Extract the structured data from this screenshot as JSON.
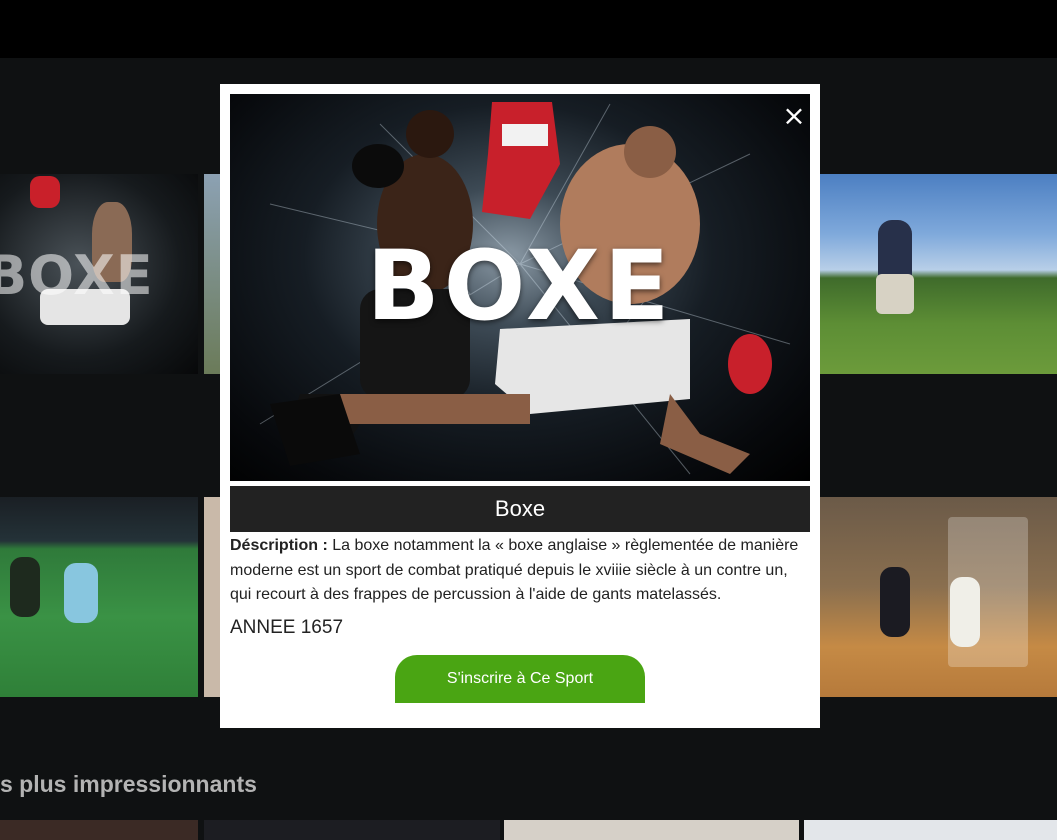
{
  "background": {
    "small_tile_word": "BOXE",
    "section_title": "s plus impressionnants"
  },
  "modal": {
    "hero_word": "BOXE",
    "close_icon": "×",
    "title": "Boxe",
    "description_label": "Déscription :",
    "description_text": " La boxe notamment la « boxe anglaise » règlementée de manière moderne est un sport de combat pratiqué depuis le xviiie siècle à un contre un, qui recourt à des frappes de percussion à l'aide de gants matelassés.",
    "year": "ANNEE 1657",
    "cta_label": "S'inscrire à Ce Sport"
  },
  "colors": {
    "cta": "#4aa513",
    "title_bar": "#222222",
    "backdrop": "#0f1112"
  }
}
